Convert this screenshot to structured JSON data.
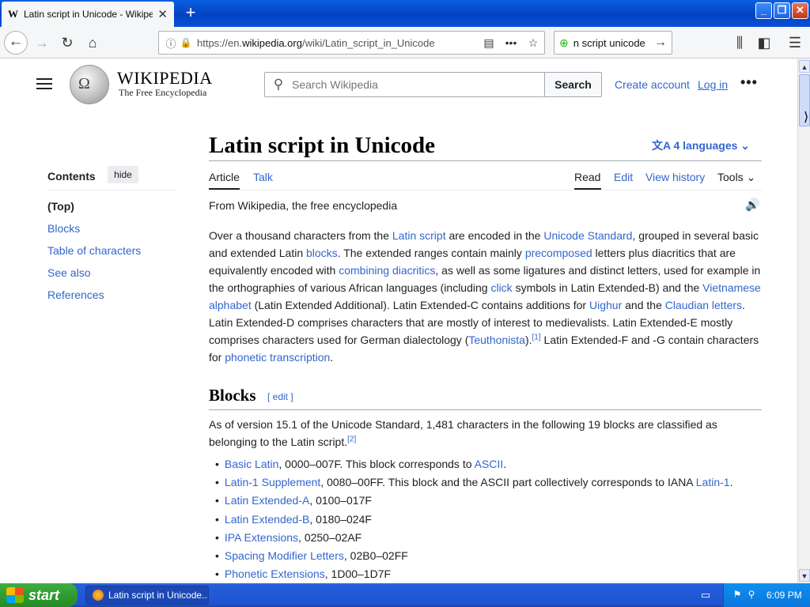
{
  "browser": {
    "tab_title": "Latin script in Unicode - Wikipedia",
    "tab_favicon": "W",
    "url_prefix": "https://en.",
    "url_domain": "wikipedia.org",
    "url_path": "/wiki/Latin_script_in_Unicode",
    "search_text": "n script unicode",
    "icons": [
      "back-icon",
      "forward-icon",
      "reload-icon",
      "home-icon",
      "info-icon",
      "lock-icon",
      "reader-icon",
      "more-icon",
      "bookmark-star-icon",
      "library-icon",
      "sidebar-icon",
      "menu-icon"
    ]
  },
  "wiki": {
    "logo_word": "WIKIPEDIA",
    "logo_tagline": "The Free Encyclopedia",
    "search_placeholder": "Search Wikipedia",
    "search_button": "Search",
    "create_account": "Create account",
    "login": "Log in",
    "more": "•••"
  },
  "toc": {
    "title": "Contents",
    "hide": "hide",
    "items": [
      "(Top)",
      "Blocks",
      "Table of characters",
      "See also",
      "References"
    ]
  },
  "article": {
    "title": "Latin script in Unicode",
    "languages": "4 languages",
    "tabs": {
      "article": "Article",
      "talk": "Talk",
      "read": "Read",
      "edit": "Edit",
      "history": "View history",
      "tools": "Tools"
    },
    "from": "From Wikipedia, the free encyclopedia",
    "lead": {
      "t1": "Over a thousand characters from the ",
      "l1": "Latin script",
      "t2": " are encoded in the ",
      "l2": "Unicode Standard",
      "t3": ", grouped in several basic and extended Latin ",
      "l3": "blocks",
      "t4": ". The extended ranges contain mainly ",
      "l4": "precomposed",
      "t5": " letters plus diacritics that are equivalently encoded with ",
      "l5": "combining diacritics",
      "t6": ", as well as some ligatures and distinct letters, used for example in the orthographies of various African languages (including ",
      "l6": "click",
      "t7": " symbols in Latin Extended-B) and the ",
      "l7": "Vietnamese alphabet",
      "t8": " (Latin Extended Additional). Latin Extended-C contains additions for ",
      "l8": "Uighur",
      "t9": " and the ",
      "l9": "Claudian letters",
      "t10": ". Latin Extended-D comprises characters that are mostly of interest to medievalists. Latin Extended-E mostly comprises characters used for German dialectology (",
      "l10": "Teuthonista",
      "t11": ").",
      "ref1": "[1]",
      "t12": " Latin Extended-F and -G contain characters for ",
      "l11": "phonetic transcription",
      "t13": "."
    },
    "blocks_heading": "Blocks",
    "blocks_edit": "[ edit ]",
    "blocks_intro": "As of version 15.1 of the Unicode Standard, 1,481 characters in the following 19 blocks are classified as belonging to the Latin script.",
    "blocks_ref": "[2]",
    "blocks": [
      {
        "name": "Basic Latin",
        "range": ", 0000–007F. This block corresponds to ",
        "link2": "ASCII",
        "tail": "."
      },
      {
        "name": "Latin-1 Supplement",
        "range": ", 0080–00FF. This block and the ASCII part collectively corresponds to IANA ",
        "link2": "Latin-1",
        "tail": "."
      },
      {
        "name": "Latin Extended-A",
        "range": ", 0100–017F"
      },
      {
        "name": "Latin Extended-B",
        "range": ", 0180–024F"
      },
      {
        "name": "IPA Extensions",
        "range": ", 0250–02AF"
      },
      {
        "name": "Spacing Modifier Letters",
        "range": ", 02B0–02FF"
      },
      {
        "name": "Phonetic Extensions",
        "range": ", 1D00–1D7F"
      }
    ]
  },
  "taskbar": {
    "start": "start",
    "task_title": "Latin script in Unicode...",
    "clock": "6:09 PM"
  }
}
